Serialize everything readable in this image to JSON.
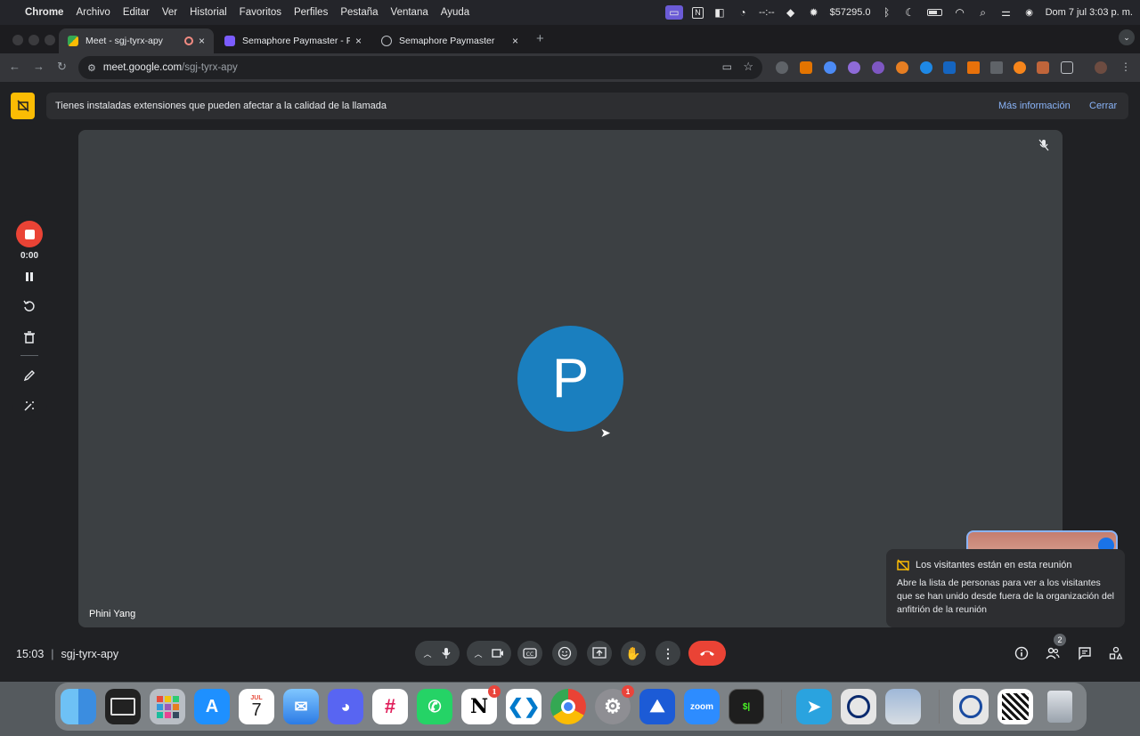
{
  "menubar": {
    "app_name": "Chrome",
    "menus": [
      "Archivo",
      "Editar",
      "Ver",
      "Historial",
      "Favoritos",
      "Perfiles",
      "Pestaña",
      "Ventana",
      "Ayuda"
    ],
    "timer_text": "--:--",
    "balance_text": "$57295.0",
    "datetime": "Dom 7 jul  3:03 p. m."
  },
  "tabs": [
    {
      "title": "Meet - sgj-tyrx-apy",
      "close": "×"
    },
    {
      "title": "Semaphore Paymaster - Pres",
      "close": "×"
    },
    {
      "title": "Semaphore Paymaster",
      "close": "×"
    }
  ],
  "new_tab": "+",
  "address": {
    "host": "meet.google.com",
    "path": "/sgj-tyrx-apy"
  },
  "banner": {
    "message": "Tienes instaladas extensiones que pueden afectar a la calidad de la llamada",
    "more_info": "Más información",
    "close": "Cerrar"
  },
  "recorder": {
    "time": "0:00"
  },
  "stage": {
    "avatar_letter": "P",
    "participant_name": "Phini Yang"
  },
  "popup": {
    "title": "Los visitantes están en esta reunión",
    "body": "Abre la lista de personas para ver a los visitantes que se han unido desde fuera de la organización del anfitrión de la reunión"
  },
  "meeting": {
    "time": "15:03",
    "separator": "|",
    "code": "sgj-tyrx-apy"
  },
  "people_count": "2",
  "dock": {
    "calendar_month": "JUL",
    "calendar_day": "7",
    "zoom_label": "zoom",
    "notion_badge": "1",
    "settings_badge": "1"
  },
  "colors": {
    "accent_blue": "#8ab4f8",
    "avatar_blue": "#1a7fbf",
    "hangup_red": "#ea4335",
    "warning_yellow": "#fbbc04"
  }
}
